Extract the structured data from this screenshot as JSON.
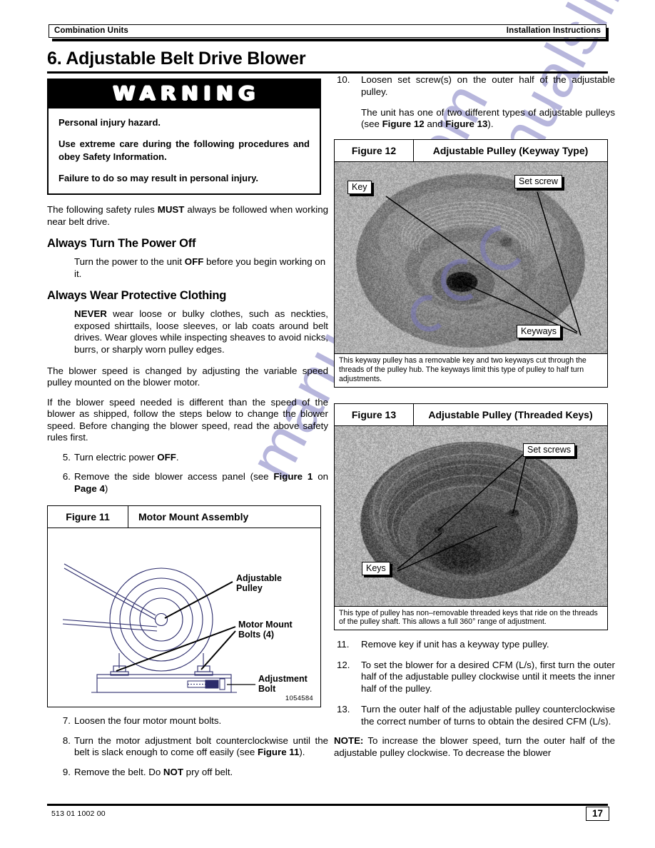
{
  "header": {
    "left": "Combination Units",
    "right": "Installation Instructions"
  },
  "chapter": {
    "title": "6. Adjustable Belt Drive Blower"
  },
  "warning": {
    "heading": "WARNING",
    "line1": "Personal injury hazard.",
    "line2": "Use extreme care during the following procedures and obey Safety Information.",
    "line3": "Failure to do so may result in personal injury."
  },
  "left_column": {
    "intro": "The following safety rules MUST always be followed when working near belt drive.",
    "intro_bold": "MUST",
    "section1_heading": "Always Turn The Power  Off",
    "section1_body": "Turn the power to the unit OFF before you begin working on it.",
    "section1_bold": "OFF",
    "section2_heading": "Always Wear Protective Clothing",
    "section2_body": "NEVER wear loose or bulky clothes, such as neckties, exposed shirttails, loose sleeves, or lab coats around belt drives. Wear gloves while inspecting sheaves to avoid nicks, burrs, or sharply worn pulley edges.",
    "section2_bold": "NEVER",
    "para3": "The blower speed is changed by adjusting the variable speed pulley mounted on the blower motor.",
    "para4": "If the blower speed needed is different than the speed of the blower as shipped, follow the steps below to change the blower speed. Before changing the blower speed, read the above safety rules first.",
    "steps": [
      {
        "num": "5.",
        "text": "Turn electric power OFF.",
        "bold": [
          "OFF"
        ]
      },
      {
        "num": "6.",
        "text": "Remove the side blower access panel (see Figure 1 on Page 4)",
        "bold": [
          "Figure 1",
          "Page 4"
        ]
      },
      {
        "num": "7.",
        "text": "Loosen the four motor mount bolts.",
        "bold": []
      },
      {
        "num": "8.",
        "text": "Turn the motor adjustment bolt counterclockwise until the belt is slack enough to come off easily (see Figure 11).",
        "bold": [
          "Figure 11"
        ]
      },
      {
        "num": "9.",
        "text": "Remove the belt. Do NOT pry off belt.",
        "bold": [
          "NOT"
        ]
      }
    ]
  },
  "right_column": {
    "steps_top": [
      {
        "num": "10.",
        "text": "Loosen set screw(s) on the outer half of the adjustable pulley.",
        "bold": []
      }
    ],
    "note_top": "The unit has one of two different types of adjustable pulleys (see Figure 12 and Figure 13).",
    "note_top_bold": [
      "Figure 12",
      "Figure 13"
    ],
    "steps_bottom": [
      {
        "num": "11.",
        "text": "Remove key if unit has a keyway type pulley.",
        "bold": []
      },
      {
        "num": "12.",
        "text": "To set the blower for a desired CFM (L/s), first turn the outer half of the adjustable pulley clockwise until it meets the inner half of the pulley.",
        "bold": []
      },
      {
        "num": "13.",
        "text": "Turn the outer half of the adjustable pulley counterclockwise the correct number of turns to obtain the desired CFM (L/s).",
        "bold": []
      }
    ],
    "final_note_label": "NOTE:",
    "final_note": "To increase the blower speed, turn the outer half of the adjustable pulley clockwise. To decrease the blower"
  },
  "figures": {
    "fig11": {
      "number": "Figure 11",
      "title": "Motor Mount Assembly",
      "labels": {
        "adjustable_pulley": "Adjustable\nPulley",
        "adjustable_pulley_l1": "Adjustable",
        "adjustable_pulley_l2": "Pulley",
        "motor_mount_bolts_l1": "Motor Mount",
        "motor_mount_bolts_l2": "Bolts (4)",
        "adjustment_bolt_l1": "Adjustment",
        "adjustment_bolt_l2": "Bolt"
      },
      "part_number": "1054584"
    },
    "fig12": {
      "number": "Figure 12",
      "title": "Adjustable Pulley (Keyway Type)",
      "callouts": {
        "key": "Key",
        "set_screw": "Set screw",
        "keyways": "Keyways"
      },
      "caption": "This keyway pulley has a removable key and two keyways cut through the threads of the pulley hub. The keyways limit this type of pulley to half turn adjustments."
    },
    "fig13": {
      "number": "Figure 13",
      "title": "Adjustable Pulley (Threaded Keys)",
      "callouts": {
        "set_screws": "Set screws",
        "keys": "Keys"
      },
      "caption": "This type of pulley has non–removable threaded keys that ride on the threads of the pulley shaft. This allows a full 360° range of adjustment."
    }
  },
  "footer": {
    "code": "513 01 1002 00",
    "page": "17"
  },
  "watermark": {
    "text": "manualslib.com",
    "color": "#8c8ac8"
  },
  "colors": {
    "ink": "#000000",
    "paper": "#ffffff",
    "photo_bg": "#a6a6a6",
    "diagram_line": "#2b2b6b"
  }
}
